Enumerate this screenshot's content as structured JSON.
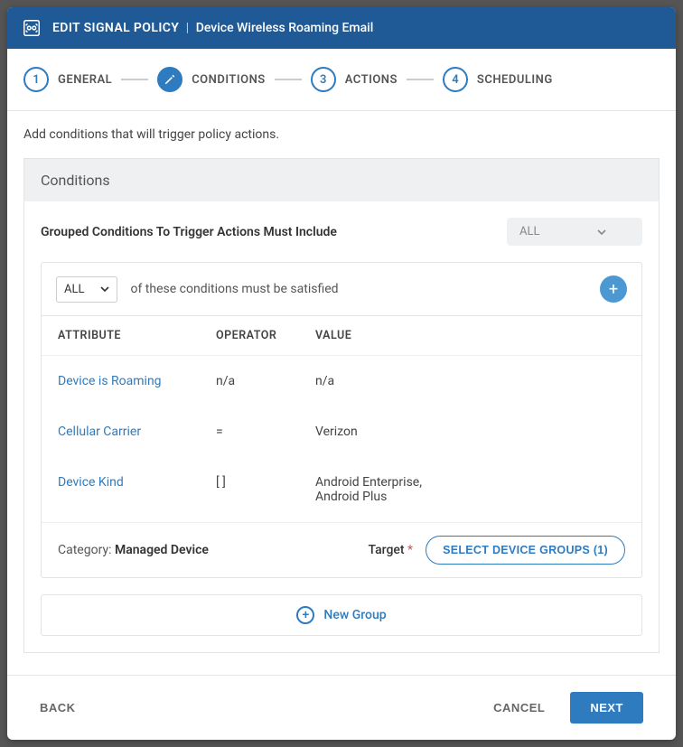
{
  "header": {
    "title": "EDIT SIGNAL POLICY",
    "separator": "|",
    "subtitle": "Device Wireless Roaming Email"
  },
  "stepper": {
    "steps": [
      {
        "num": "1",
        "label": "GENERAL"
      },
      {
        "num": "2",
        "label": "CONDITIONS"
      },
      {
        "num": "3",
        "label": "ACTIONS"
      },
      {
        "num": "4",
        "label": "SCHEDULING"
      }
    ]
  },
  "instruction": "Add conditions that will trigger policy actions.",
  "panel": {
    "title": "Conditions",
    "group_label": "Grouped Conditions To Trigger Actions Must Include",
    "group_dropdown": "ALL"
  },
  "cond": {
    "all_dropdown": "ALL",
    "help": "of these conditions must be satisfied",
    "headers": {
      "attr": "ATTRIBUTE",
      "op": "OPERATOR",
      "val": "VALUE"
    },
    "rows": [
      {
        "attr": "Device is Roaming",
        "op": "n/a",
        "val": "n/a"
      },
      {
        "attr": "Cellular Carrier",
        "op": "=",
        "val": "Verizon"
      },
      {
        "attr": "Device Kind",
        "op": "[ ]",
        "val": "Android Enterprise, Android Plus"
      }
    ],
    "category_label": "Category:",
    "category_value": "Managed Device",
    "target_label": "Target",
    "select_groups": "SELECT DEVICE GROUPS (1)",
    "new_group": "New Group"
  },
  "footer": {
    "back": "BACK",
    "cancel": "CANCEL",
    "next": "NEXT"
  }
}
